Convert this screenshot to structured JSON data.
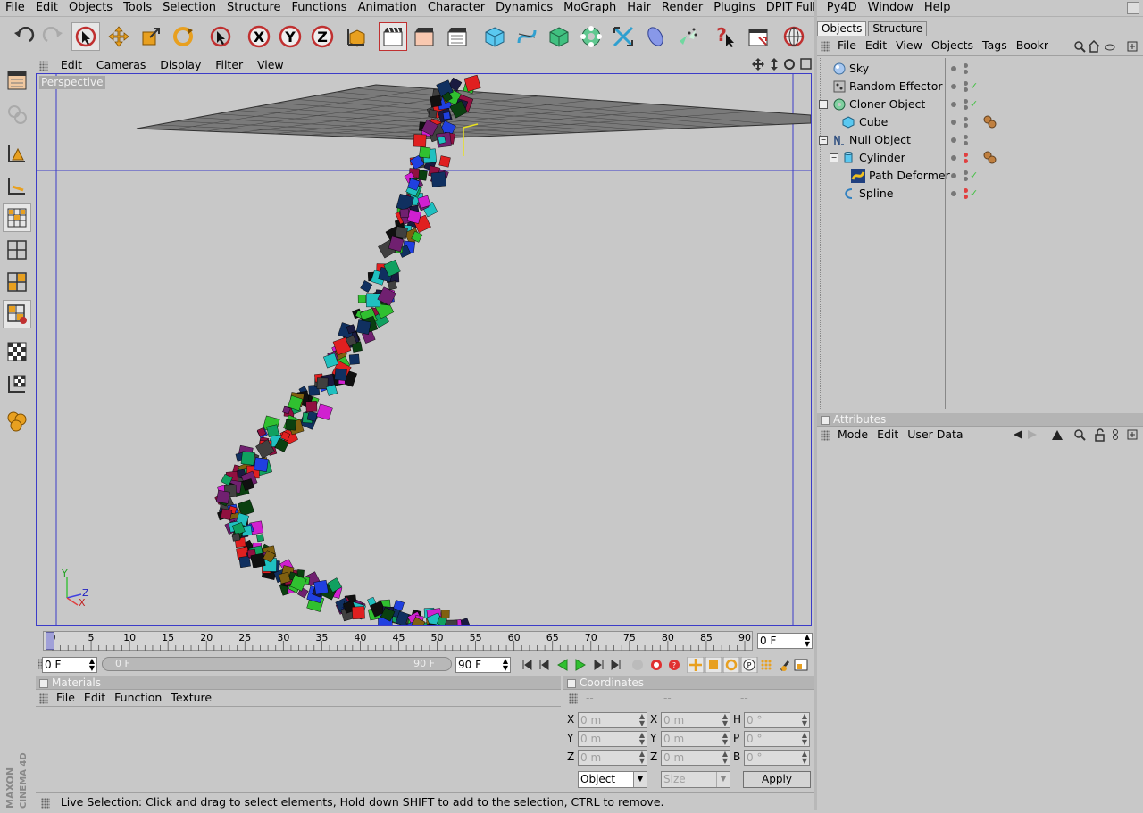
{
  "menubar": [
    "File",
    "Edit",
    "Objects",
    "Tools",
    "Selection",
    "Structure",
    "Functions",
    "Animation",
    "Character",
    "Dynamics",
    "MoGraph",
    "Hair",
    "Render",
    "Plugins",
    "DPIT Full",
    "Py4D",
    "Window",
    "Help"
  ],
  "viewport": {
    "menu": [
      "Edit",
      "Cameras",
      "Display",
      "Filter",
      "View"
    ],
    "label": "Perspective",
    "axes": {
      "y": "Y",
      "z": "Z",
      "x": "X"
    }
  },
  "timeline": {
    "ticks": [
      "0",
      "5",
      "10",
      "15",
      "20",
      "25",
      "30",
      "35",
      "40",
      "45",
      "50",
      "55",
      "60",
      "65",
      "70",
      "75",
      "80",
      "85",
      "90"
    ],
    "current_frame": "0 F",
    "start_field": "0 F",
    "range_start": "0 F",
    "range_end": "90 F",
    "end_field": "90 F"
  },
  "objects_panel": {
    "tabs": [
      "Objects",
      "Structure"
    ],
    "menu": [
      "File",
      "Edit",
      "View",
      "Objects",
      "Tags",
      "Bookr"
    ],
    "items": [
      {
        "name": "Sky",
        "depth": 0
      },
      {
        "name": "Random Effector",
        "depth": 0
      },
      {
        "name": "Cloner Object",
        "depth": 0
      },
      {
        "name": "Cube",
        "depth": 1
      },
      {
        "name": "Null Object",
        "depth": 0
      },
      {
        "name": "Cylinder",
        "depth": 1
      },
      {
        "name": "Path Deformer",
        "depth": 2
      },
      {
        "name": "Spline",
        "depth": 1
      }
    ]
  },
  "attributes_panel": {
    "title": "Attributes",
    "menu": [
      "Mode",
      "Edit",
      "User Data"
    ]
  },
  "materials_panel": {
    "title": "Materials",
    "menu": [
      "File",
      "Edit",
      "Function",
      "Texture"
    ]
  },
  "coordinates_panel": {
    "title": "Coordinates",
    "col_headers": [
      "--",
      "--",
      "--"
    ],
    "rows": [
      {
        "l1": "X",
        "v1": "0 m",
        "l2": "X",
        "v2": "0 m",
        "l3": "H",
        "v3": "0 °"
      },
      {
        "l1": "Y",
        "v1": "0 m",
        "l2": "Y",
        "v2": "0 m",
        "l3": "P",
        "v3": "0 °"
      },
      {
        "l1": "Z",
        "v1": "0 m",
        "l2": "Z",
        "v2": "0 m",
        "l3": "B",
        "v3": "0 °"
      }
    ],
    "mode_select": "Object",
    "size_select": "Size",
    "apply_label": "Apply"
  },
  "status_text": "Live Selection: Click and drag to select elements, Hold down SHIFT to add to the selection, CTRL to remove.",
  "brand": "MAXON CINEMA 4D",
  "colors": {
    "accent": "#3c3cc8",
    "panel": "#c8c8c8",
    "header": "#b4b4b4"
  }
}
